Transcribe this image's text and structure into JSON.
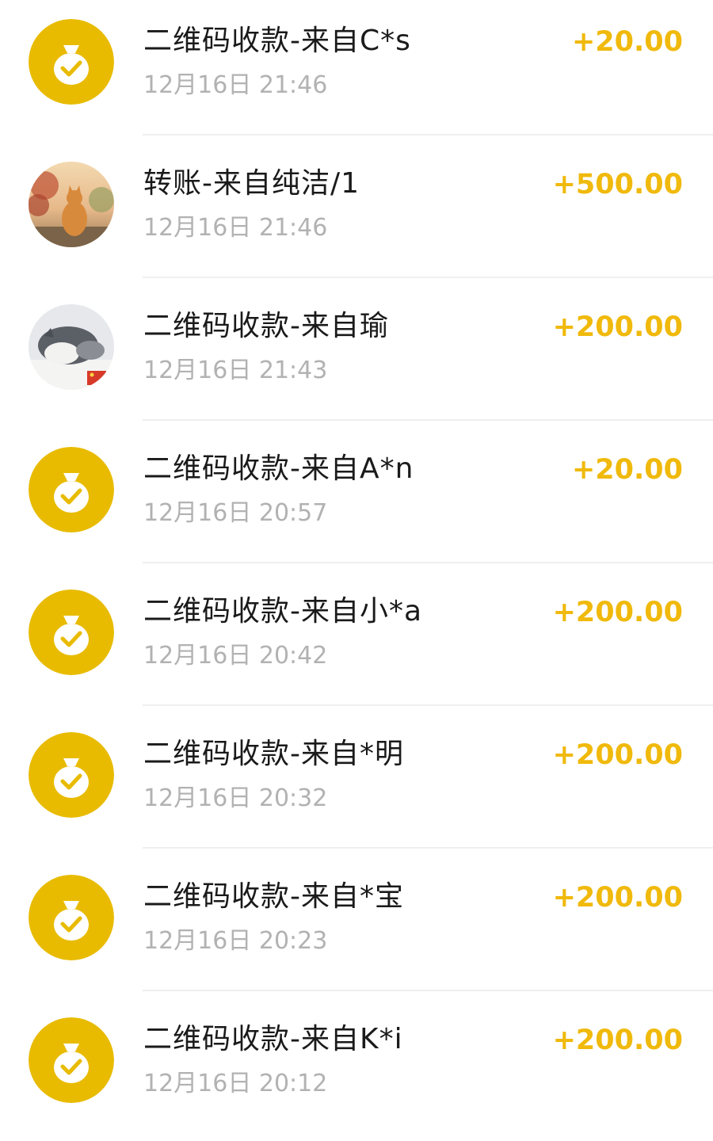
{
  "colors": {
    "accent": "#f0b90b",
    "icon_bg": "#e8bb00",
    "title": "#1a1a1a",
    "time": "#b2b2b2",
    "divider": "#efefef"
  },
  "transactions": [
    {
      "title": "二维码收款-来自C*s",
      "time": "12月16日 21:46",
      "amount": "+20.00",
      "avatar": "money-bag-icon"
    },
    {
      "title": "转账-来自纯洁/1",
      "time": "12月16日 21:46",
      "amount": "+500.00",
      "avatar": "user-photo-cat"
    },
    {
      "title": "二维码收款-来自瑜",
      "time": "12月16日 21:43",
      "amount": "+200.00",
      "avatar": "user-photo-cat-sleeping"
    },
    {
      "title": "二维码收款-来自A*n",
      "time": "12月16日 20:57",
      "amount": "+20.00",
      "avatar": "money-bag-icon"
    },
    {
      "title": "二维码收款-来自小*a",
      "time": "12月16日 20:42",
      "amount": "+200.00",
      "avatar": "money-bag-icon"
    },
    {
      "title": "二维码收款-来自*明",
      "time": "12月16日 20:32",
      "amount": "+200.00",
      "avatar": "money-bag-icon"
    },
    {
      "title": "二维码收款-来自*宝",
      "time": "12月16日 20:23",
      "amount": "+200.00",
      "avatar": "money-bag-icon"
    },
    {
      "title": "二维码收款-来自K*i",
      "time": "12月16日 20:12",
      "amount": "+200.00",
      "avatar": "money-bag-icon"
    }
  ]
}
